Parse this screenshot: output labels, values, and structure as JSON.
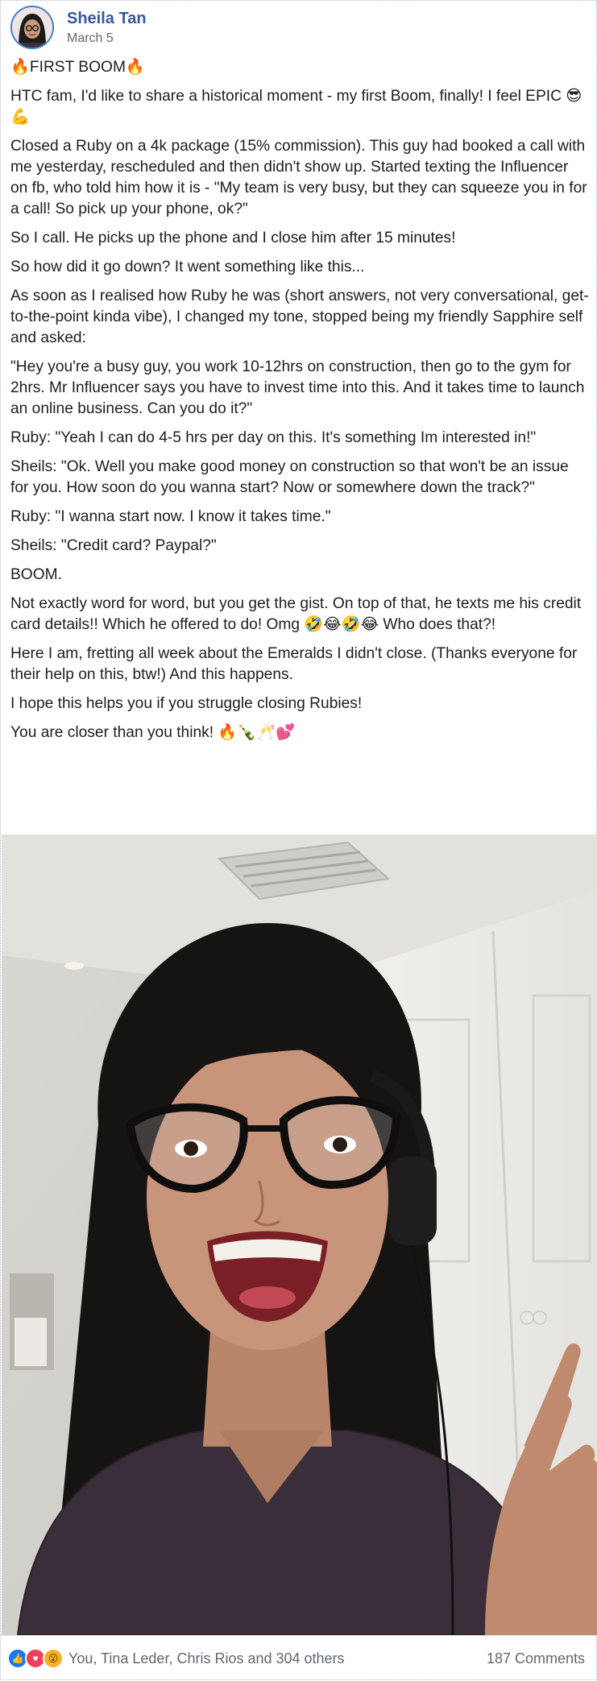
{
  "post": {
    "author": "Sheila Tan",
    "date": "March 5",
    "paragraphs": [
      "🔥FIRST BOOM🔥",
      "HTC fam, I'd like to share a historical moment - my first Boom, finally! I feel EPIC 😎💪",
      "Closed a Ruby on a 4k package (15% commission). This guy had booked a call with me yesterday, rescheduled and then didn't show up. Started texting the Influencer on fb, who told him how it is - \"My team is very busy, but they can squeeze you in for a call! So pick up your phone, ok?\"",
      "So I call. He picks up the phone and I close him after 15 minutes!",
      "So how did it go down? It went something like this...",
      "As soon as I realised how Ruby he was (short answers, not very conversational, get-to-the-point kinda vibe), I changed my tone, stopped being my friendly Sapphire self and asked:",
      "\"Hey you're a busy guy, you work 10-12hrs on construction, then go to the gym for 2hrs. Mr Influencer says you have to invest time into this. And it takes time to launch an online business. Can you do it?\"",
      "Ruby: \"Yeah I can do 4-5 hrs per day on this. It's something Im interested in!\"",
      "Sheils: \"Ok. Well you make good money on construction so that won't be an issue for you. How soon do you wanna start? Now or somewhere down the track?\"",
      "Ruby: \"I wanna start now. I know it takes time.\"",
      "Sheils: \"Credit card? Paypal?\"",
      "BOOM.",
      "Not exactly word for word, but you get the gist. On top of that, he texts me his credit card details!! Which he offered to do! Omg 🤣😂🤣😂 Who does that?!",
      "Here I am, fretting all week about the Emeralds I didn't close. (Thanks everyone for their help on this, btw!) And this happens.",
      "I hope this helps you if you struggle closing Rubies!",
      "You are closer than you think! 🔥🍾🥂💕"
    ]
  },
  "footer": {
    "reactions_text": "You, Tina Leder, Chris Rios and 304 others",
    "comments_text": "187 Comments",
    "reaction_icons": [
      "like-icon",
      "love-icon",
      "wow-icon"
    ]
  },
  "colors": {
    "author": "#385898",
    "meta": "#606770",
    "like": "#1877f2",
    "love": "#f33e58",
    "wow": "#f7b125"
  }
}
